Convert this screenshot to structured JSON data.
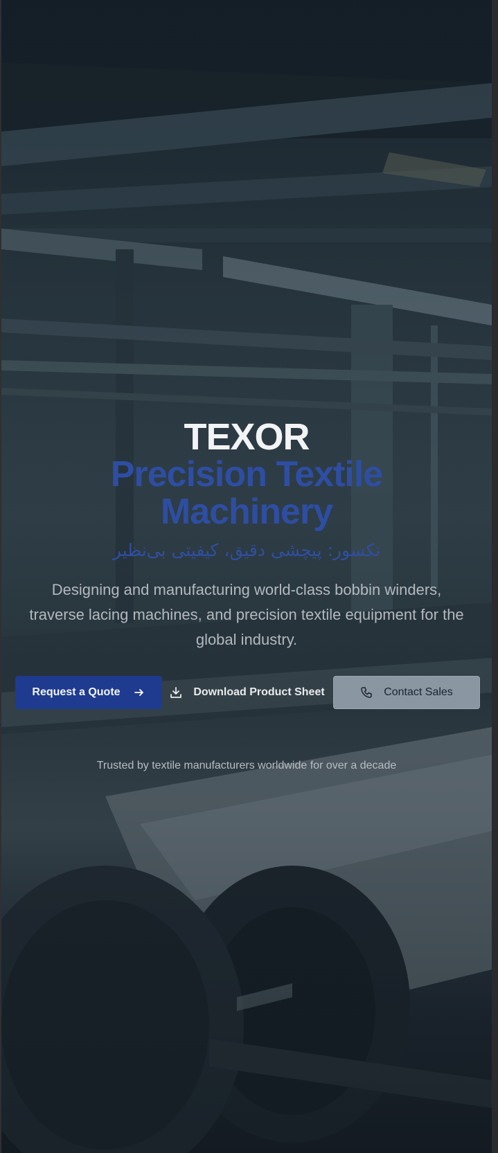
{
  "hero": {
    "brand": "TEXOR",
    "headline_line1": "Precision Textile",
    "headline_line2": "Machinery",
    "persian_tagline": "تکسور: پیچشی دقیق، کیفیتی بی‌نظیر",
    "subtitle": "Designing and manufacturing world-class bobbin winders, traverse lacing machines, and precision textile equipment for the global industry.",
    "trusted_note": "Trusted by textile manufacturers worldwide for over a decade"
  },
  "actions": {
    "quote_label": "Request a Quote",
    "quote_icon": "arrow-right-icon",
    "download_label": "Download Product Sheet",
    "download_icon": "download-icon",
    "contact_label": "Contact Sales",
    "contact_icon": "phone-icon"
  },
  "colors": {
    "accent_blue": "#2e4ea3",
    "quote_button": "#1f3b8f",
    "contact_button": "#8a97a3",
    "heading_white": "#f2f3f5"
  }
}
